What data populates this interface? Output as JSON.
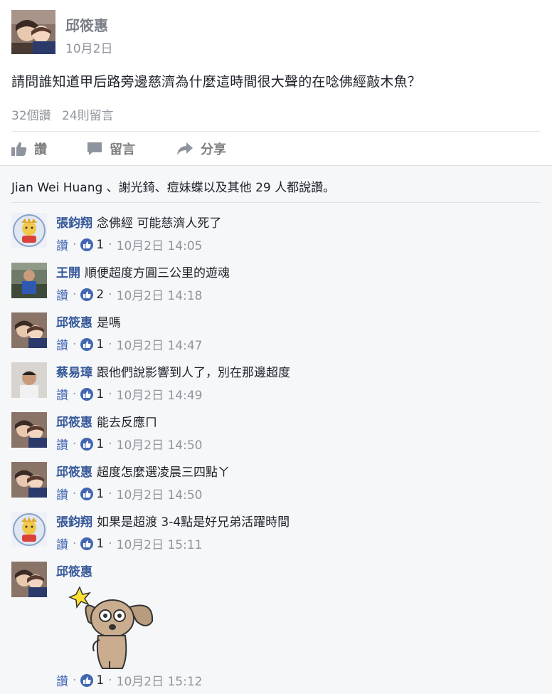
{
  "post": {
    "author": "邱筱惠",
    "date": "10月2日",
    "body": "請問誰知道甲后路旁邊慈濟為什麼這時間很大聲的在唸佛經敲木魚？",
    "stats": {
      "likes": "32個讚",
      "comments": "24則留言"
    }
  },
  "actions": {
    "like_label": "讚",
    "comment_label": "留言",
    "share_label": "分享"
  },
  "likes_summary": "Jian Wei Huang 、謝光錡、痘妹蝶以及其他 29 人都說讚。",
  "comments": [
    {
      "name": "張鈞翔",
      "text": "念佛經 可能慈濟人死了",
      "like_label": "讚",
      "like_count": "1",
      "time": "10月2日 14:05"
    },
    {
      "name": "王開",
      "text": "順便超度方圓三公里的遊魂",
      "like_label": "讚",
      "like_count": "2",
      "time": "10月2日 14:18"
    },
    {
      "name": "邱筱惠",
      "text": "是嗎",
      "like_label": "讚",
      "like_count": "1",
      "time": "10月2日 14:47"
    },
    {
      "name": "蔡易璋",
      "text": "跟他們說影響到人了，別在那邊超度",
      "like_label": "讚",
      "like_count": "1",
      "time": "10月2日 14:49"
    },
    {
      "name": "邱筱惠",
      "text": "能去反應ㄇ",
      "like_label": "讚",
      "like_count": "1",
      "time": "10月2日 14:50"
    },
    {
      "name": "邱筱惠",
      "text": "超度怎麼選凌晨三四點ㄚ",
      "like_label": "讚",
      "like_count": "1",
      "time": "10月2日 14:50"
    },
    {
      "name": "張鈞翔",
      "text": "如果是超渡 3-4點是好兄弟活躍時間",
      "like_label": "讚",
      "like_count": "1",
      "time": "10月2日 15:11"
    },
    {
      "name": "邱筱惠",
      "text": "",
      "like_label": "讚",
      "like_count": "1",
      "time": "10月2日 15:12"
    }
  ],
  "colors": {
    "link_blue": "#365899",
    "like_blue": "#4267b2",
    "meta_gray": "#90949c",
    "comment_bg": "#f6f7f9"
  }
}
